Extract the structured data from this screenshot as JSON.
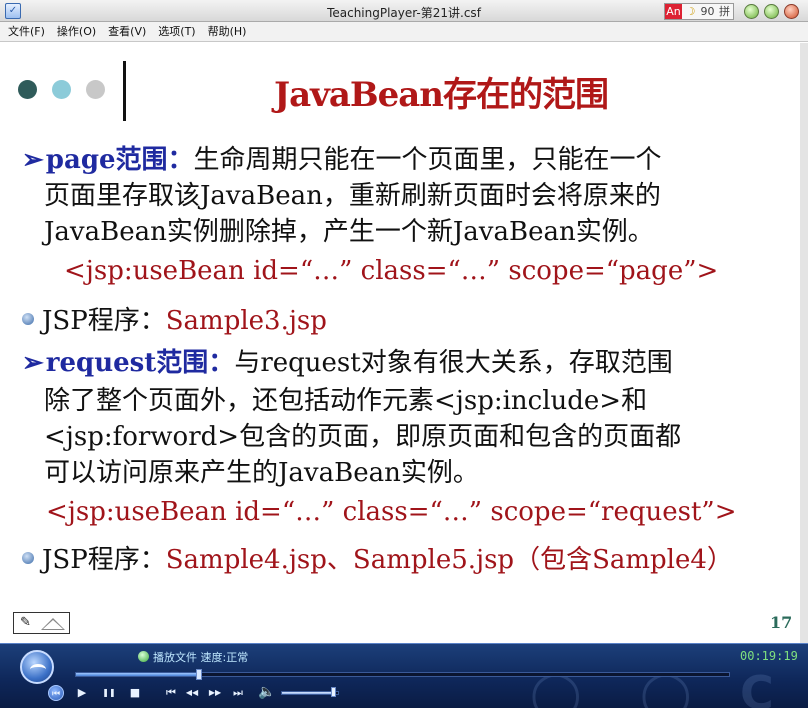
{
  "window": {
    "title": "TeachingPlayer-第21讲.csf",
    "app_icon_glyph": "✓"
  },
  "ime_bar": {
    "items": [
      "An",
      "☽",
      "90",
      "拼"
    ]
  },
  "menu": {
    "items": [
      "文件(F)",
      "操作(O)",
      "查看(V)",
      "选项(T)",
      "帮助(H)"
    ]
  },
  "slide": {
    "title": "JavaBean存在的范围",
    "page_number": "17",
    "page_scope": {
      "keyword": "page范围：",
      "line1": "生命周期只能在一个页面里，只能在一个",
      "line2": "页面里存取该JavaBean，重新刷新页面时会将原来的",
      "line3": "JavaBean实例删除掉，产生一个新JavaBean实例。",
      "code": "<jsp:useBean  id=“…”  class=“…”  scope=“page”>",
      "jsp_label": "JSP程序：",
      "jsp_file": "Sample3.jsp"
    },
    "request_scope": {
      "keyword": "request范围：",
      "line1": "与request对象有很大关系，存取范围",
      "line2": "除了整个页面外，还包括动作元素<jsp:include>和",
      "line3": "<jsp:forword>包含的页面，即原页面和包含的页面都",
      "line4": "可以访问原来产生的JavaBean实例。",
      "code": "<jsp:useBean  id=“…”  class=“…”  scope=“request”>",
      "jsp_label": "JSP程序：",
      "jsp_file": "Sample4.jsp、Sample5.jsp（包含Sample4）"
    }
  },
  "player": {
    "status": "播放文件 速度:正常",
    "time": "00:19:19",
    "progress_fraction": 0.19,
    "volume_fraction": 0.92,
    "controls": {
      "prev_glyph": "⏮",
      "play_glyph": "▶",
      "pause_glyph": "❚❚",
      "stop_glyph": "■",
      "skip_back_glyph": "⏮",
      "rewind_glyph": "◀◀",
      "forward_glyph": "▶▶",
      "skip_forward_glyph": "⏭",
      "volume_glyph": "🔈"
    }
  },
  "colors": {
    "title_red": "#b01818",
    "keyword_blue": "#1f2aa0",
    "code_red": "#a0141a",
    "page_number_green": "#2b6b5b",
    "player_bg": "#0e2658"
  }
}
